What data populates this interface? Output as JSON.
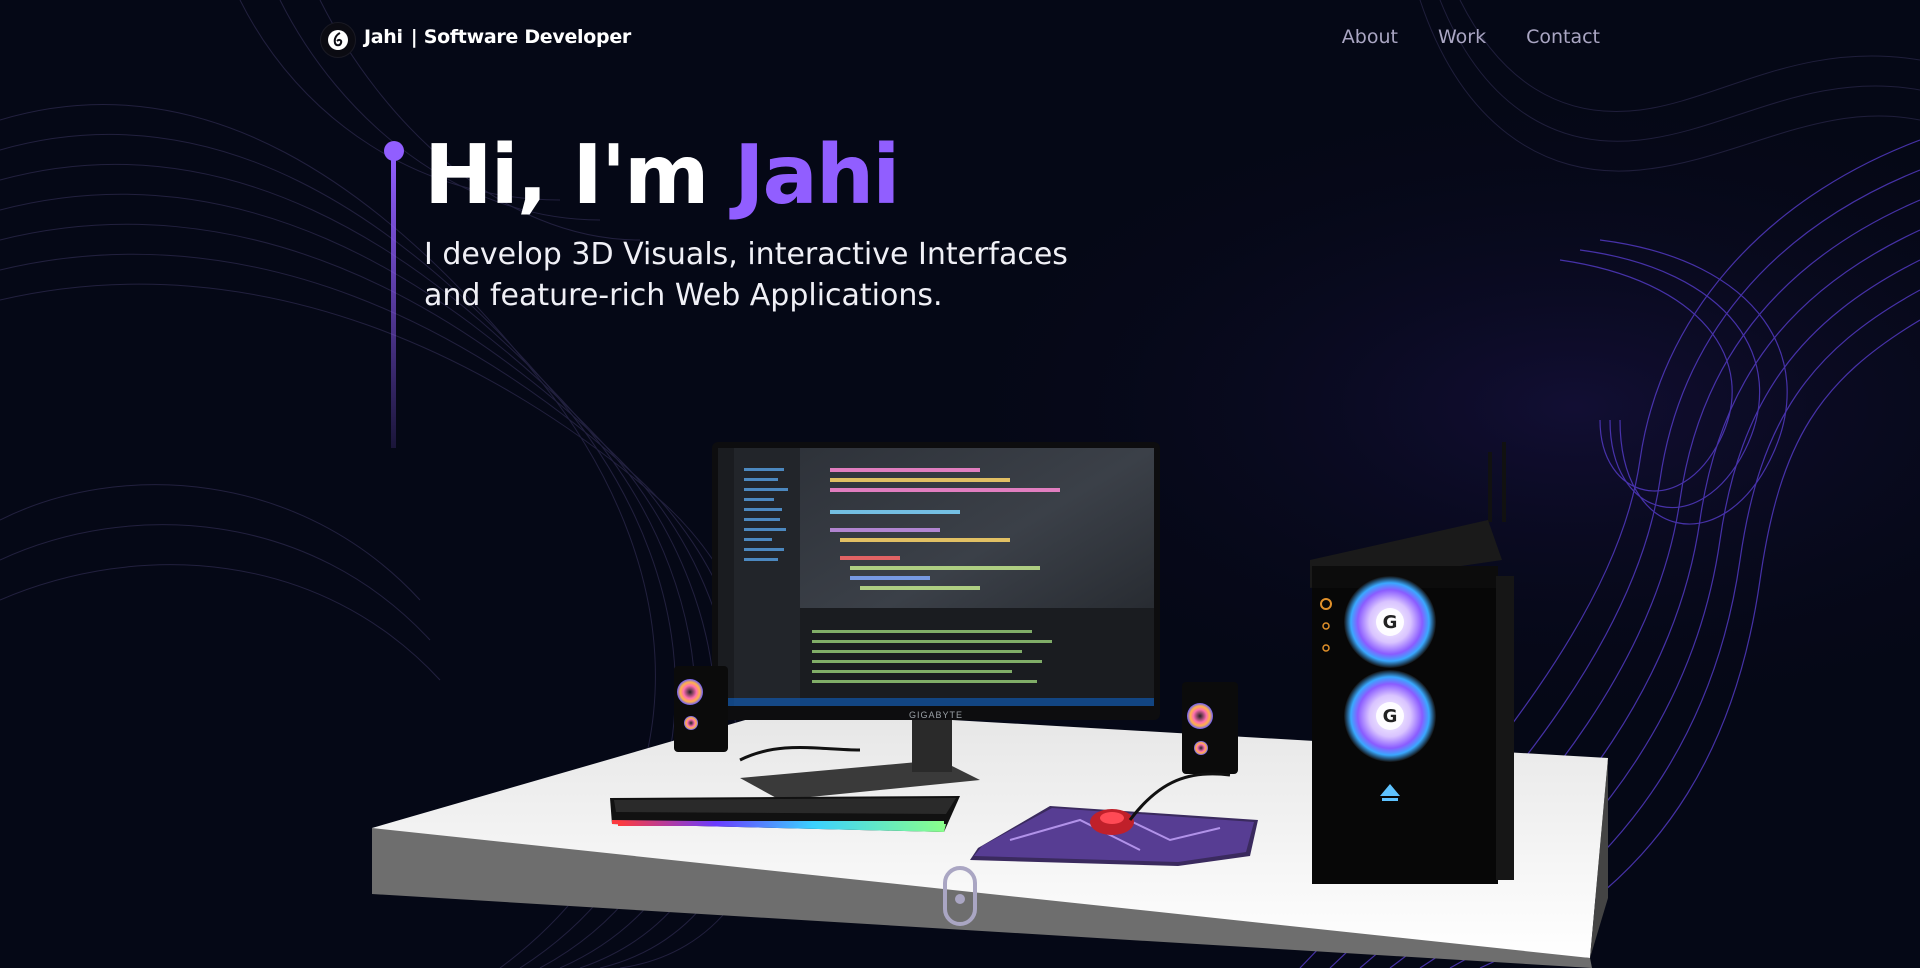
{
  "nav": {
    "brand_name": "Jahi",
    "brand_role": "| Software Developer",
    "links": [
      "About",
      "Work",
      "Contact"
    ]
  },
  "hero": {
    "greeting": "Hi, I'm ",
    "name": "Jahi",
    "subtitle_line1": "I develop 3D Visuals, interactive Interfaces",
    "subtitle_line2": "and feature-rich Web Applications."
  },
  "scene": {
    "monitor_brand": "GIGABYTE"
  },
  "colors": {
    "background": "#050816",
    "accent": "#915eff",
    "nav_text": "#aaa6c3"
  },
  "icons": [
    "logo-icon",
    "scroll-indicator-icon"
  ]
}
